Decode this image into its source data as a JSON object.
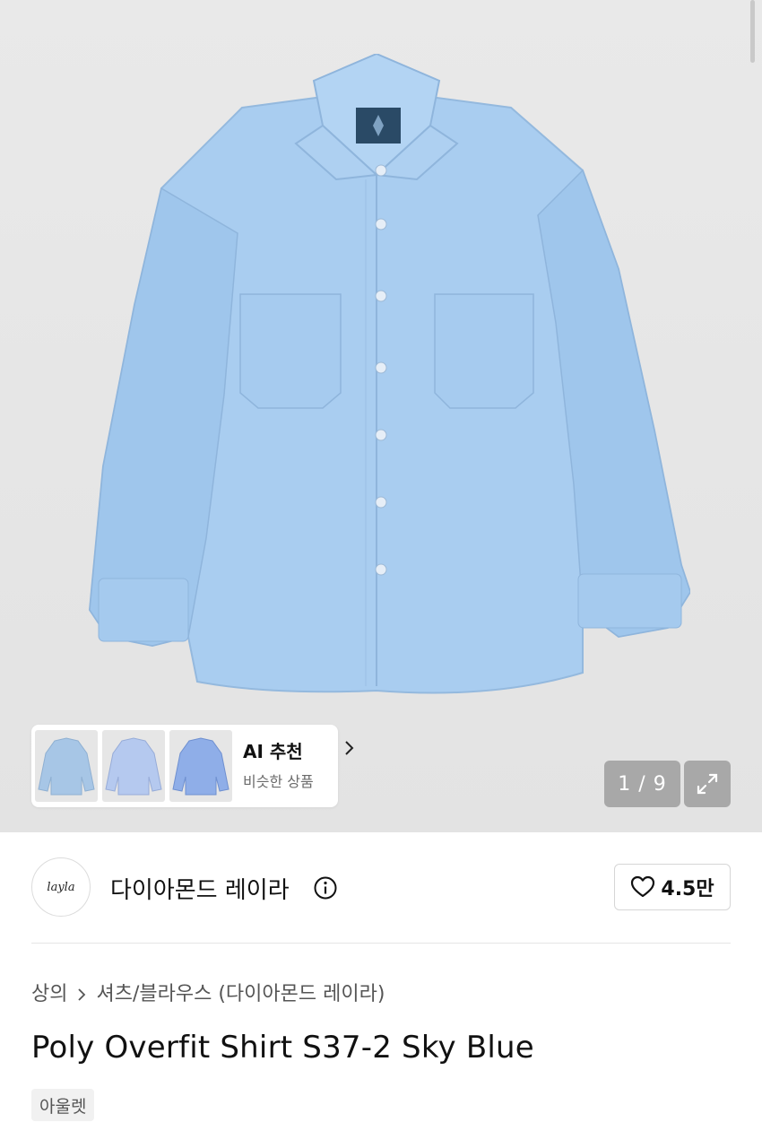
{
  "gallery": {
    "counter": "1 / 9",
    "ai_card": {
      "title": "AI 추천",
      "subtitle": "비슷한 상품"
    }
  },
  "brand": {
    "logo_text": "layla",
    "name": "다이아몬드 레이라",
    "likes": "4.5만"
  },
  "breadcrumb": {
    "category": "상의",
    "subcategory": "셔츠/블라우스 (다이아몬드 레이라)"
  },
  "product": {
    "title": "Poly Overfit Shirt S37-2 Sky Blue",
    "tag": "아울렛"
  },
  "icons": {
    "expand": "expand-icon",
    "info": "info-icon",
    "heart": "heart-icon",
    "chevron": "chevron-right-icon"
  },
  "colors": {
    "shirt": "#a9cdf0",
    "background": "#e6e6e6"
  }
}
